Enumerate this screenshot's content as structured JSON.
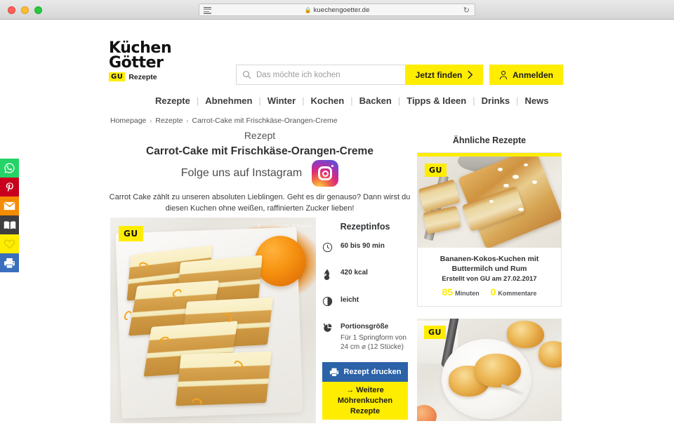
{
  "browser": {
    "url": "kuechengoetter.de",
    "lock_icon": "lock-icon",
    "reader_icon": "reader-view-icon",
    "reload_icon": "reload-icon"
  },
  "social_rail": [
    {
      "name": "whatsapp",
      "label": "WhatsApp",
      "color": "#25d366"
    },
    {
      "name": "pinterest",
      "label": "Pinterest",
      "color": "#c8001e"
    },
    {
      "name": "email",
      "label": "E-Mail",
      "color": "#f58b00"
    },
    {
      "name": "read",
      "label": "Lesen",
      "color": "#3f3f3f"
    },
    {
      "name": "favorite",
      "label": "Merken",
      "color": "#ffed00"
    },
    {
      "name": "print",
      "label": "Drucken",
      "color": "#3b6fbd"
    }
  ],
  "header": {
    "logo_line1": "Küchen",
    "logo_line2": "Götter",
    "logo_badge": "GU",
    "logo_sub": "Rezepte",
    "search_placeholder": "Das möchte ich kochen",
    "search_value": "",
    "find_button": "Jetzt finden",
    "find_button_arrow": "›",
    "login_button": "Anmelden"
  },
  "nav": {
    "items": [
      "Rezepte",
      "Abnehmen",
      "Winter",
      "Kochen",
      "Backen",
      "Tipps & Ideen",
      "Drinks",
      "News"
    ],
    "separator": "|"
  },
  "breadcrumb": {
    "items": [
      "Homepage",
      "Rezepte"
    ],
    "current": "Carrot-Cake mit Frischkäse-Orangen-Creme",
    "separator": "›"
  },
  "recipe": {
    "kicker": "Rezept",
    "title": "Carrot-Cake mit Frischkäse-Orangen-Creme",
    "instagram_text": "Folge uns auf Instagram",
    "instagram_icon": "instagram-icon",
    "intro": "Carrot Cake zählt zu unseren absoluten Lieblingen. Geht es dir genauso? Dann wirst du diesen Kuchen ohne weißen, raffinierten Zucker lieben!",
    "photo_badge": "GU",
    "photo_credit": "© Grossmann Schuerle"
  },
  "infos": {
    "title": "Rezeptinfos",
    "rows": [
      {
        "icon": "clock-icon",
        "text": "60 bis 90 min",
        "sub": ""
      },
      {
        "icon": "flame-icon",
        "text": "420 kcal",
        "sub": ""
      },
      {
        "icon": "difficulty-icon",
        "text": "leicht",
        "sub": ""
      },
      {
        "icon": "portion-icon",
        "text": "Portionsgröße",
        "sub": "Für 1 Springform von 24 cm ⌀ (12 Stücke)"
      }
    ],
    "print_button": "Rezept drucken",
    "print_icon": "printer-icon",
    "more_button": "→ Weitere Möhrenkuchen Rezepte",
    "print_button_color": "#2b62a8",
    "more_button_color": "#ffed00"
  },
  "sidebar": {
    "title": "Ähnliche Rezepte",
    "cards": [
      {
        "badge": "GU",
        "title": "Bananen-Kokos-Kuchen mit Buttermilch und Rum",
        "meta": "Erstellt von GU am 27.02.2017",
        "minutes_value": "85",
        "minutes_label": "Minuten",
        "comments_value": "0",
        "comments_label": "Kommentare"
      },
      {
        "badge": "GU",
        "title": "",
        "meta": "",
        "minutes_value": "",
        "minutes_label": "",
        "comments_value": "",
        "comments_label": ""
      }
    ]
  },
  "colors": {
    "brand_yellow": "#ffed00",
    "print_blue": "#2b62a8",
    "text_dark": "#2f3133",
    "text_muted": "#55565a"
  }
}
